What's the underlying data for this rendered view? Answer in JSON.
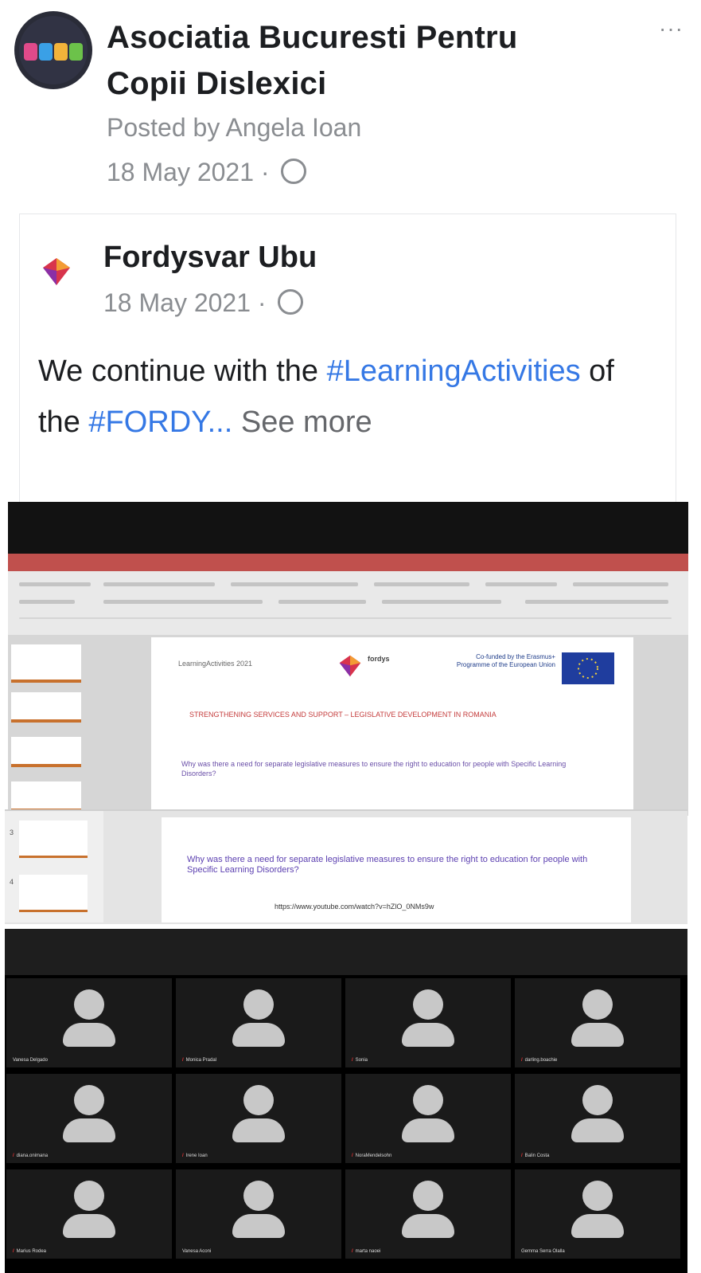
{
  "header": {
    "group_name": "Asociatia Bucuresti Pentru Copii Dislexici",
    "posted_by": "Posted by Angela Ioan",
    "date": "18 May 2021 · ",
    "more_label": "···"
  },
  "shared_post": {
    "page_name": "Fordysvar Ubu",
    "date": "18 May 2021 · ",
    "text_before": "We continue with the ",
    "hashtag_1": "#LearningActivities",
    "text_middle": " of the ",
    "hashtag_2": "#FORDY...",
    "see_more": " See more"
  },
  "slide": {
    "subtitle": "LearningActivities 2021",
    "logo_text": "fordys",
    "eu_text": "Co-funded by the Erasmus+ Programme of the European Union",
    "red_heading": "STRENGTHENING SERVICES AND SUPPORT – LEGISLATIVE DEVELOPMENT IN ROMANIA",
    "question_blur": "Why was there a need for separate legislative measures to ensure the right to education for people with Specific Learning Disorders?",
    "question": "Why was there a need for separate legislative measures to ensure the right to education for people with Specific Learning Disorders?",
    "link": "https://www.youtube.com/watch?v=hZlO_0NMs9w",
    "slide_numbers": [
      "3",
      "4"
    ]
  },
  "participants": [
    {
      "name": "Vanesa Delgado",
      "muted": false
    },
    {
      "name": "Monica Pradal",
      "muted": true
    },
    {
      "name": "Sonia",
      "muted": true
    },
    {
      "name": "darling.boachie",
      "muted": true
    },
    {
      "name": "diana.onimana",
      "muted": true
    },
    {
      "name": "Irene Ioan",
      "muted": true
    },
    {
      "name": "NoraMendelsohn",
      "muted": true
    },
    {
      "name": "Balin Costa",
      "muted": true
    },
    {
      "name": "Marius Rodea",
      "muted": true
    },
    {
      "name": "Vanesa Aconi",
      "muted": false
    },
    {
      "name": "marta naoei",
      "muted": true
    },
    {
      "name": "Gemma Serra Olalla",
      "muted": false
    }
  ],
  "colors": {
    "hashtag": "#3578e5",
    "muted_text": "#8a8d91",
    "brand_accent": "#c8712d",
    "title_bar": "#c0504d"
  }
}
